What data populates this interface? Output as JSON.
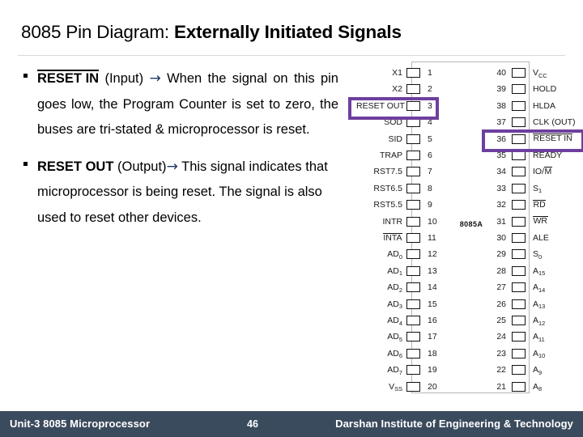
{
  "slide": {
    "title_plain": "8085 Pin Diagram: ",
    "title_bold": "Externally Initiated Signals",
    "accent_purple": "#6d3f9e",
    "footer_bg": "#3b4b5e",
    "arrow_color": "#1f3864"
  },
  "bullets": [
    {
      "signal": "RESET IN",
      "signal_overline": true,
      "direction": "(Input)",
      "arrow": "→",
      "description": "When the signal on this pin goes low, the Program Counter is set to zero, the buses are tri-stated & microprocessor is reset."
    },
    {
      "signal": "RESET OUT",
      "signal_overline": false,
      "direction": "(Output)",
      "arrow": "→",
      "description": "This signal indicates that microprocessor is being reset. The signal is also used to reset other devices."
    }
  ],
  "pin_diagram": {
    "chip_name": "8085A",
    "highlighted_pins": [
      3,
      36
    ],
    "left_pins": [
      {
        "num": "1",
        "label": "X1",
        "sub": "",
        "overline": false
      },
      {
        "num": "2",
        "label": "X2",
        "sub": "",
        "overline": false
      },
      {
        "num": "3",
        "label": "RESET OUT",
        "sub": "",
        "overline": false
      },
      {
        "num": "4",
        "label": "SOD",
        "sub": "",
        "overline": false
      },
      {
        "num": "5",
        "label": "SID",
        "sub": "",
        "overline": false
      },
      {
        "num": "6",
        "label": "TRAP",
        "sub": "",
        "overline": false
      },
      {
        "num": "7",
        "label": "RST7.5",
        "sub": "",
        "overline": false
      },
      {
        "num": "8",
        "label": "RST6.5",
        "sub": "",
        "overline": false
      },
      {
        "num": "9",
        "label": "RST5.5",
        "sub": "",
        "overline": false
      },
      {
        "num": "10",
        "label": "INTR",
        "sub": "",
        "overline": false
      },
      {
        "num": "11",
        "label": "INTA",
        "sub": "",
        "overline": true
      },
      {
        "num": "12",
        "label": "AD",
        "sub": "0",
        "overline": false
      },
      {
        "num": "13",
        "label": "AD",
        "sub": "1",
        "overline": false
      },
      {
        "num": "14",
        "label": "AD",
        "sub": "2",
        "overline": false
      },
      {
        "num": "15",
        "label": "AD",
        "sub": "3",
        "overline": false
      },
      {
        "num": "16",
        "label": "AD",
        "sub": "4",
        "overline": false
      },
      {
        "num": "17",
        "label": "AD",
        "sub": "5",
        "overline": false
      },
      {
        "num": "18",
        "label": "AD",
        "sub": "6",
        "overline": false
      },
      {
        "num": "19",
        "label": "AD",
        "sub": "7",
        "overline": false
      },
      {
        "num": "20",
        "label": "V",
        "sub": "SS",
        "overline": false
      }
    ],
    "right_pins": [
      {
        "num": "40",
        "label": "V",
        "sub": "CC",
        "overline": false
      },
      {
        "num": "39",
        "label": "HOLD",
        "sub": "",
        "overline": false
      },
      {
        "num": "38",
        "label": "HLDA",
        "sub": "",
        "overline": false
      },
      {
        "num": "37",
        "label": "CLK (OUT)",
        "sub": "",
        "overline": false
      },
      {
        "num": "36",
        "label": "RESET IN",
        "sub": "",
        "overline": true
      },
      {
        "num": "35",
        "label": "READY",
        "sub": "",
        "overline": false
      },
      {
        "num": "34",
        "label": "IO/M",
        "sub": "",
        "overline": "partial"
      },
      {
        "num": "33",
        "label": "S",
        "sub": "1",
        "overline": false
      },
      {
        "num": "32",
        "label": "RD",
        "sub": "",
        "overline": true
      },
      {
        "num": "31",
        "label": "WR",
        "sub": "",
        "overline": true
      },
      {
        "num": "30",
        "label": "ALE",
        "sub": "",
        "overline": false
      },
      {
        "num": "29",
        "label": "S",
        "sub": "0",
        "overline": false
      },
      {
        "num": "28",
        "label": "A",
        "sub": "15",
        "overline": false
      },
      {
        "num": "27",
        "label": "A",
        "sub": "14",
        "overline": false
      },
      {
        "num": "26",
        "label": "A",
        "sub": "13",
        "overline": false
      },
      {
        "num": "25",
        "label": "A",
        "sub": "12",
        "overline": false
      },
      {
        "num": "24",
        "label": "A",
        "sub": "11",
        "overline": false
      },
      {
        "num": "23",
        "label": "A",
        "sub": "10",
        "overline": false
      },
      {
        "num": "22",
        "label": "A",
        "sub": "9",
        "overline": false
      },
      {
        "num": "21",
        "label": "A",
        "sub": "8",
        "overline": false
      }
    ]
  },
  "footer": {
    "left": "Unit-3 8085 Microprocessor",
    "page": "46",
    "right": "Darshan Institute of Engineering & Technology"
  }
}
